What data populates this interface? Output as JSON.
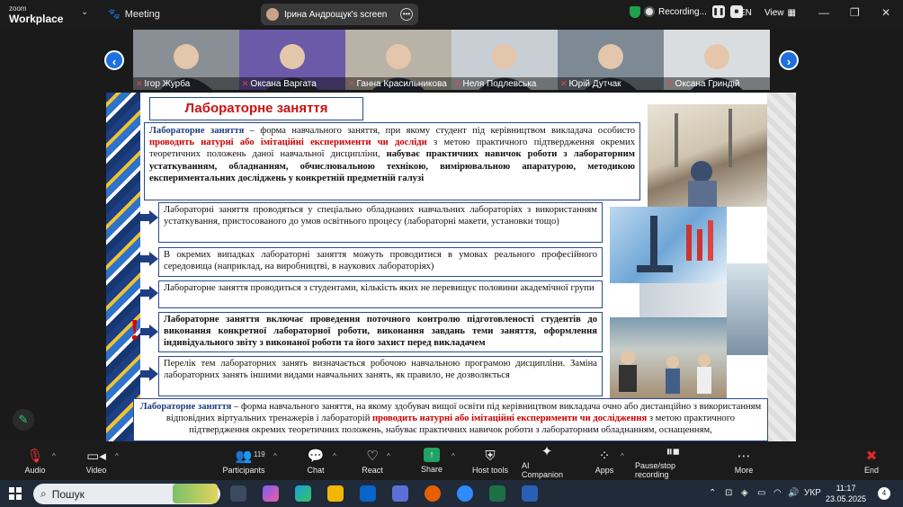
{
  "titlebar": {
    "logo_small": "zoom",
    "logo_big": "Workplace",
    "meeting_label": "Meeting",
    "screen_share_label": "Ірина  Андрощук's screen",
    "recording_label": "Recording...",
    "language": "EN",
    "view_label": "View"
  },
  "gallery": {
    "participants": [
      {
        "name": "Ігор Журба",
        "bg": "#8a8f95"
      },
      {
        "name": "Оксана Варгата",
        "bg": "#6a5aa8"
      },
      {
        "name": "Ганна Красильникова",
        "bg": "#b9b2a6"
      },
      {
        "name": "Неля Подлевська",
        "bg": "#c8cfd4"
      },
      {
        "name": "Юрій Дутчак",
        "bg": "#7d8a96"
      },
      {
        "name": "Оксана Гриндій",
        "bg": "#d9dde0"
      }
    ]
  },
  "slide": {
    "title": "Лабораторне заняття",
    "definition": {
      "p1": "Лабораторне заняття",
      "p2": " – форма навчального заняття, при якому студент під керівництвом викладача особисто ",
      "p3": "проводить натурні або імітаційні експерименти чи досліди",
      "p4": " з метою практичного підтвердження окремих теоретичних положень даної навчальної дисципліни, ",
      "p5": "набуває практичних навичок роботи з лабораторним устаткуванням, обладнанням, обчислювальною технікою, вимірювальною апаратурою, методикою експериментальних досліджень у конкретній предметній галузі"
    },
    "rules": [
      "Лабораторні заняття проводяться у спеціально обладнаних навчальних лабораторіях з використанням устаткування, пристосованого до умов освітнього процесу (лабораторні макети, установки тощо)",
      "В окремих випадках лабораторні заняття можуть проводитися в умовах реального професійного середовища (наприклад, на виробництві, в наукових лабораторіях)",
      "Лабораторне заняття проводиться з студентами, кількість яких не перевищує половини академічної групи",
      "Лабораторне заняття включає проведення поточного контролю підготовленості студентів до виконання конкретної лабораторної роботи, виконання завдань теми заняття, оформлення індивідуального звіту з виконаної роботи та його захист перед викладачем",
      "Перелік тем лабораторних занять визначається робочою навчальною програмою дисципліни. Заміна лабораторних занять іншими видами навчальних занять, як правило, не дозволяється"
    ],
    "exclamation": "!",
    "bottom": {
      "b1": "Лабораторне заняття",
      "b2": " – форма навчального заняття, на якому здобувач вищої освіти під керівництвом викладача очно або дистанційно з використанням відповідних віртуальних тренажерів і лабораторій ",
      "b3": "проводить натурні або імітаційні експерименти чи дослідження",
      "b4": " з метою практичного підтвердження окремих теоретичних положень, набуває практичних навичок роботи з лабораторним обладнанням, оснащенням,"
    }
  },
  "toolbar": {
    "audio": "Audio",
    "video": "Video",
    "participants": "Participants",
    "participants_count": "119",
    "chat": "Chat",
    "react": "React",
    "share": "Share",
    "host_tools": "Host tools",
    "ai_companion": "AI Companion",
    "apps": "Apps",
    "pause_stop": "Pause/stop recording",
    "more": "More",
    "end": "End"
  },
  "taskbar": {
    "search_placeholder": "Пошук",
    "lang": "УКР",
    "time": "11:17",
    "date": "23.05.2025",
    "notif_count": "4"
  },
  "colors": {
    "accent_blue": "#1e6fe0",
    "slide_border": "#2a4b8d",
    "emphasis_red": "#cc0000",
    "share_green": "#21a366",
    "end_red": "#e02828"
  }
}
